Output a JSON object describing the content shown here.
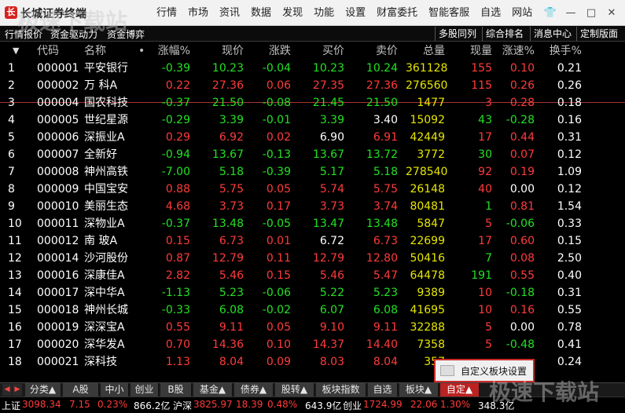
{
  "app_title": "长城证券终端",
  "menu": [
    "行情",
    "市场",
    "资讯",
    "数据",
    "发现",
    "功能",
    "设置",
    "财富委托",
    "智能客服",
    "自选",
    "网站"
  ],
  "window_buttons": {
    "shirt": "👕",
    "minimize": "—",
    "maximize": "□",
    "close": "✕"
  },
  "toolbar": {
    "left": [
      "行情报价",
      "资金驱动力",
      "资金博弈"
    ],
    "right": [
      "多股同列",
      "综合排名",
      "消息中心",
      "定制版面"
    ]
  },
  "columns": {
    "sort": "▼",
    "code": "代码",
    "name": "名称",
    "dot": "•",
    "pct": "涨幅%",
    "price": "现价",
    "chg": "涨跌",
    "bid": "买价",
    "ask": "卖价",
    "vol": "总量",
    "cur": "现量",
    "speed": "涨速%",
    "turn": "换手%"
  },
  "rows": [
    {
      "no": "1",
      "code": "000001",
      "name": "平安银行",
      "pct": "-0.39",
      "price": "10.23",
      "chg": "-0.04",
      "bid": "10.23",
      "ask": "10.24",
      "vol": "361128",
      "cur": "155",
      "speed": "0.10",
      "turn": "0.21",
      "d": "dn",
      "sd": "up",
      "cd": "up",
      "pb": "dn",
      "pa": "dn"
    },
    {
      "no": "2",
      "code": "000002",
      "name": "万 科A",
      "pct": "0.22",
      "price": "27.36",
      "chg": "0.06",
      "bid": "27.35",
      "ask": "27.36",
      "vol": "276560",
      "cur": "115",
      "speed": "0.26",
      "turn": "0.26",
      "d": "up",
      "sd": "up",
      "cd": "up",
      "pb": "up",
      "pa": "up"
    },
    {
      "no": "3",
      "code": "000004",
      "name": "国农科技",
      "pct": "-0.37",
      "price": "21.50",
      "chg": "-0.08",
      "bid": "21.45",
      "ask": "21.50",
      "vol": "1477",
      "cur": "3",
      "speed": "0.28",
      "turn": "0.18",
      "d": "dn",
      "sd": "up",
      "cd": "up",
      "pb": "dn",
      "pa": "dn"
    },
    {
      "no": "4",
      "code": "000005",
      "name": "世纪星源",
      "pct": "-0.29",
      "price": "3.39",
      "chg": "-0.01",
      "bid": "3.39",
      "ask": "3.40",
      "vol": "15092",
      "cur": "43",
      "speed": "-0.28",
      "turn": "0.16",
      "d": "dn",
      "sd": "dn",
      "cd": "dn",
      "pb": "dn",
      "pa": "fl"
    },
    {
      "no": "5",
      "code": "000006",
      "name": "深振业A",
      "pct": "0.29",
      "price": "6.92",
      "chg": "0.02",
      "bid": "6.90",
      "ask": "6.91",
      "vol": "42449",
      "cur": "17",
      "speed": "0.44",
      "turn": "0.31",
      "d": "up",
      "sd": "up",
      "cd": "up",
      "pb": "fl",
      "pa": "up"
    },
    {
      "no": "6",
      "code": "000007",
      "name": "全新好",
      "pct": "-0.94",
      "price": "13.67",
      "chg": "-0.13",
      "bid": "13.67",
      "ask": "13.72",
      "vol": "3772",
      "cur": "30",
      "speed": "0.07",
      "turn": "0.12",
      "d": "dn",
      "sd": "up",
      "cd": "dn",
      "pb": "dn",
      "pa": "dn"
    },
    {
      "no": "7",
      "code": "000008",
      "name": "神州高铁",
      "pct": "-7.00",
      "price": "5.18",
      "chg": "-0.39",
      "bid": "5.17",
      "ask": "5.18",
      "vol": "278540",
      "cur": "92",
      "speed": "0.19",
      "turn": "1.09",
      "d": "dn",
      "sd": "up",
      "cd": "up",
      "pb": "dn",
      "pa": "dn"
    },
    {
      "no": "8",
      "code": "000009",
      "name": "中国宝安",
      "pct": "0.88",
      "price": "5.75",
      "chg": "0.05",
      "bid": "5.74",
      "ask": "5.75",
      "vol": "26148",
      "cur": "40",
      "speed": "0.00",
      "turn": "0.12",
      "d": "up",
      "sd": "fl",
      "cd": "up",
      "pb": "up",
      "pa": "up"
    },
    {
      "no": "9",
      "code": "000010",
      "name": "美丽生态",
      "pct": "4.68",
      "price": "3.73",
      "chg": "0.17",
      "bid": "3.73",
      "ask": "3.74",
      "vol": "80481",
      "cur": "1",
      "speed": "0.81",
      "turn": "1.54",
      "d": "up",
      "sd": "up",
      "cd": "dn",
      "pb": "up",
      "pa": "up"
    },
    {
      "no": "10",
      "code": "000011",
      "name": "深物业A",
      "pct": "-0.37",
      "price": "13.48",
      "chg": "-0.05",
      "bid": "13.47",
      "ask": "13.48",
      "vol": "5847",
      "cur": "5",
      "speed": "-0.06",
      "turn": "0.33",
      "d": "dn",
      "sd": "dn",
      "cd": "up",
      "pb": "dn",
      "pa": "dn"
    },
    {
      "no": "11",
      "code": "000012",
      "name": "南 玻A",
      "pct": "0.15",
      "price": "6.73",
      "chg": "0.01",
      "bid": "6.72",
      "ask": "6.73",
      "vol": "22699",
      "cur": "17",
      "speed": "0.60",
      "turn": "0.15",
      "d": "up",
      "sd": "up",
      "cd": "up",
      "pb": "fl",
      "pa": "up"
    },
    {
      "no": "12",
      "code": "000014",
      "name": "沙河股份",
      "pct": "0.87",
      "price": "12.79",
      "chg": "0.11",
      "bid": "12.79",
      "ask": "12.80",
      "vol": "50416",
      "cur": "7",
      "speed": "0.08",
      "turn": "2.50",
      "d": "up",
      "sd": "up",
      "cd": "dn",
      "pb": "up",
      "pa": "up"
    },
    {
      "no": "13",
      "code": "000016",
      "name": "深康佳A",
      "pct": "2.82",
      "price": "5.46",
      "chg": "0.15",
      "bid": "5.46",
      "ask": "5.47",
      "vol": "64478",
      "cur": "191",
      "speed": "0.55",
      "turn": "0.40",
      "d": "up",
      "sd": "up",
      "cd": "dn",
      "pb": "up",
      "pa": "up"
    },
    {
      "no": "14",
      "code": "000017",
      "name": "深中华A",
      "pct": "-1.13",
      "price": "5.23",
      "chg": "-0.06",
      "bid": "5.22",
      "ask": "5.23",
      "vol": "9389",
      "cur": "10",
      "speed": "-0.18",
      "turn": "0.31",
      "d": "dn",
      "sd": "dn",
      "cd": "up",
      "pb": "dn",
      "pa": "dn"
    },
    {
      "no": "15",
      "code": "000018",
      "name": "神州长城",
      "pct": "-0.33",
      "price": "6.08",
      "chg": "-0.02",
      "bid": "6.07",
      "ask": "6.08",
      "vol": "41695",
      "cur": "10",
      "speed": "0.16",
      "turn": "0.55",
      "d": "dn",
      "sd": "up",
      "cd": "up",
      "pb": "dn",
      "pa": "dn"
    },
    {
      "no": "16",
      "code": "000019",
      "name": "深深宝A",
      "pct": "0.55",
      "price": "9.11",
      "chg": "0.05",
      "bid": "9.10",
      "ask": "9.11",
      "vol": "32288",
      "cur": "5",
      "speed": "0.00",
      "turn": "0.78",
      "d": "up",
      "sd": "fl",
      "cd": "up",
      "pb": "up",
      "pa": "up"
    },
    {
      "no": "17",
      "code": "000020",
      "name": "深华发A",
      "pct": "0.70",
      "price": "14.36",
      "chg": "0.10",
      "bid": "14.37",
      "ask": "14.40",
      "vol": "7358",
      "cur": "5",
      "speed": "-0.48",
      "turn": "0.41",
      "d": "up",
      "sd": "dn",
      "cd": "up",
      "pb": "up",
      "pa": "up"
    },
    {
      "no": "18",
      "code": "000021",
      "name": "深科技",
      "pct": "1.13",
      "price": "8.04",
      "chg": "0.09",
      "bid": "8.03",
      "ask": "8.04",
      "vol": "357",
      "cur": "",
      "speed": "",
      "turn": "0.24",
      "d": "up",
      "sd": "up",
      "cd": "dn",
      "pb": "up",
      "pa": "up"
    }
  ],
  "context_menu": {
    "label": "自定义板块设置"
  },
  "tabs": [
    "分类▲",
    "A股",
    "中小",
    "创业",
    "B股",
    "基金▲",
    "债券▲",
    "股转▲",
    "板块指数",
    "自选",
    "板块▲",
    "自定▲"
  ],
  "tab_arrows": [
    "◀",
    "▶"
  ],
  "status": {
    "sh_label": "上证",
    "sh_val": "3098.34",
    "sh_chg": "7.15",
    "sh_pct": "0.23%",
    "sh_amt": "866.2亿",
    "sz_label": "沪深",
    "sz_val": "3825.97",
    "sz_chg": "18.39",
    "sz_pct": "0.48%",
    "sz_amt": "643.9亿",
    "cy_label": "创业",
    "cy_val": "1724.99",
    "cy_chg": "22.06",
    "cy_pct": "1.30%",
    "cy_amt": "348.3亿"
  },
  "watermark": [
    "极速下载站",
    "极速下载站"
  ]
}
